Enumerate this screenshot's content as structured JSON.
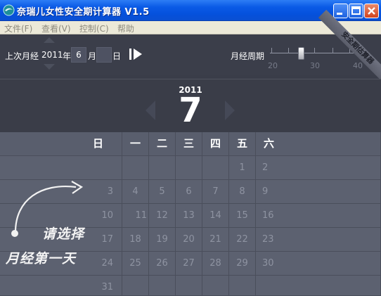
{
  "window": {
    "title": "奈瑞儿女性安全期计算器 V1.5"
  },
  "menu": [
    "文件(F)",
    "查看(V)",
    "控制(C)",
    "帮助"
  ],
  "controls": {
    "last_period_label": "上次月经",
    "year_value": "2011",
    "year_unit": "年",
    "month_value": "6",
    "month_unit": "月",
    "day_value": "",
    "day_unit": "日",
    "cycle_label": "月经周期",
    "cycle_ticks": [
      "20",
      "30",
      "40"
    ],
    "cycle_value": 28,
    "ribbon": "安全期估算器"
  },
  "calendar": {
    "year": "2011",
    "month": "7",
    "weekdays": [
      "日",
      "一",
      "二",
      "三",
      "四",
      "五",
      "六"
    ],
    "weeks": [
      [
        "",
        "",
        "",
        "",
        "",
        "1",
        "2"
      ],
      [
        "3",
        "4",
        "5",
        "6",
        "7",
        "8",
        "9"
      ],
      [
        "10",
        "11",
        "12",
        "13",
        "14",
        "15",
        "16"
      ],
      [
        "17",
        "18",
        "19",
        "20",
        "21",
        "22",
        "23"
      ],
      [
        "24",
        "25",
        "26",
        "27",
        "28",
        "29",
        "30"
      ],
      [
        "31",
        "",
        "",
        "",
        "",
        "",
        ""
      ]
    ]
  },
  "hint": {
    "line1": "请选择",
    "line2": "月经第一天"
  }
}
